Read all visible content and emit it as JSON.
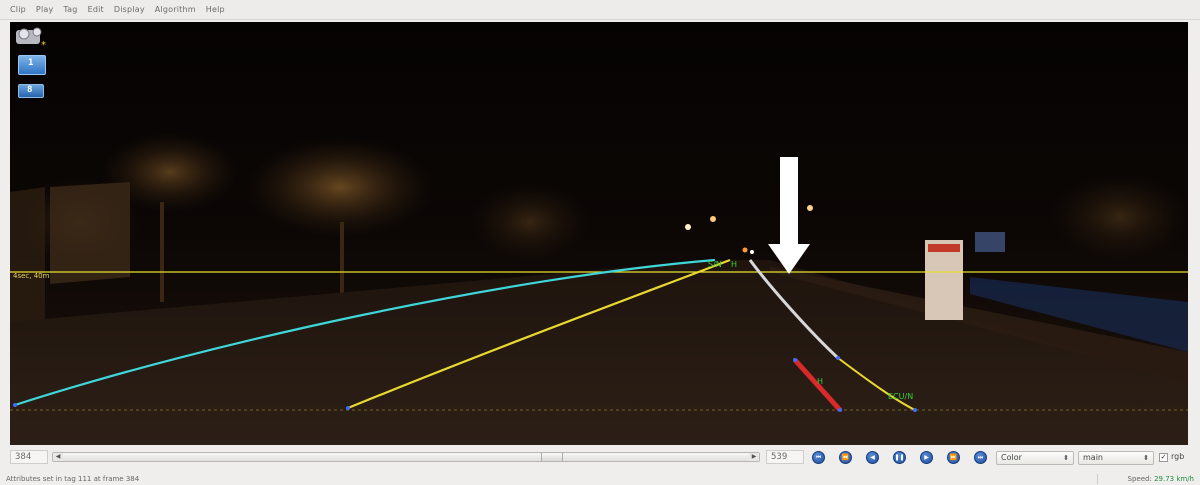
{
  "menu": [
    "Clip",
    "Play",
    "Tag",
    "Edit",
    "Display",
    "Algorithm",
    "Help"
  ],
  "overlay": {
    "channel_1": "1",
    "channel_8": "8",
    "star": "*",
    "distance_label": "4sec, 40m",
    "lane_tags": {
      "far_left": "S/N",
      "far_right": "H",
      "near_red": "H",
      "near_right": "ECU/N"
    }
  },
  "controls": {
    "start_frame": "384",
    "end_frame": "539",
    "color_select": "Color",
    "view_select": "main",
    "rgb_checked": "✓",
    "rgb_label": "rgb"
  },
  "status": {
    "message": "Attributes set in tag 111 at frame 384",
    "speed_label": "Speed:",
    "speed_value": "29.73 km/h"
  },
  "colors": {
    "lane_cyan": "#3fd6d9",
    "lane_yellow": "#e8d830",
    "lane_red": "#d92a2a",
    "lane_white": "#d8d8d8",
    "horizon": "#e8e030",
    "label_green": "#3bcc3b"
  },
  "icons": [
    "camera-icon",
    "first-frame-icon",
    "rewind-fast-icon",
    "step-back-icon",
    "pause-icon",
    "play-icon",
    "forward-fast-icon",
    "last-frame-icon"
  ]
}
